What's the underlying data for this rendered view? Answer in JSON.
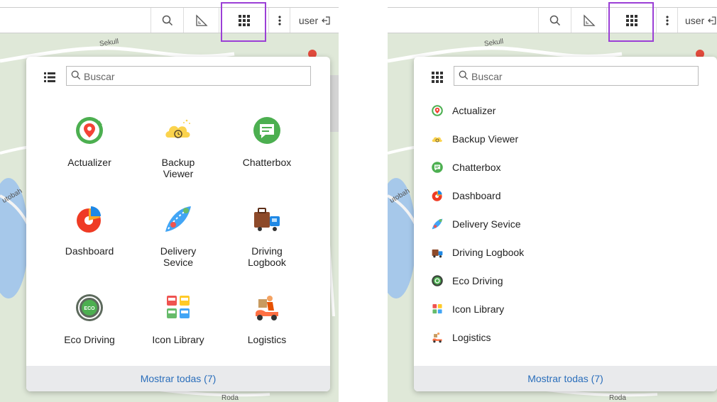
{
  "panels": [
    {
      "view": "grid",
      "topbar": {
        "user_label": "user"
      },
      "search": {
        "placeholder": "Buscar"
      },
      "apps": [
        {
          "label": "Actualizer",
          "icon": "actualizer-icon"
        },
        {
          "label": "Backup\nViewer",
          "icon": "backup-viewer-icon"
        },
        {
          "label": "Chatterbox",
          "icon": "chatterbox-icon"
        },
        {
          "label": "Dashboard",
          "icon": "dashboard-icon"
        },
        {
          "label": "Delivery\nSevice",
          "icon": "delivery-service-icon"
        },
        {
          "label": "Driving\nLogbook",
          "icon": "driving-logbook-icon"
        },
        {
          "label": "Eco Driving",
          "icon": "eco-driving-icon"
        },
        {
          "label": "Icon Library",
          "icon": "icon-library-icon"
        },
        {
          "label": "Logistics",
          "icon": "logistics-icon"
        }
      ],
      "footer": "Mostrar todas (7)",
      "map_labels": [
        "Sekull",
        "utobah",
        "Roda"
      ]
    },
    {
      "view": "list",
      "topbar": {
        "user_label": "user"
      },
      "search": {
        "placeholder": "Buscar"
      },
      "apps": [
        {
          "label": "Actualizer",
          "icon": "actualizer-icon"
        },
        {
          "label": "Backup Viewer",
          "icon": "backup-viewer-icon"
        },
        {
          "label": "Chatterbox",
          "icon": "chatterbox-icon"
        },
        {
          "label": "Dashboard",
          "icon": "dashboard-icon"
        },
        {
          "label": "Delivery Sevice",
          "icon": "delivery-service-icon"
        },
        {
          "label": "Driving Logbook",
          "icon": "driving-logbook-icon"
        },
        {
          "label": "Eco Driving",
          "icon": "eco-driving-icon"
        },
        {
          "label": "Icon Library",
          "icon": "icon-library-icon"
        },
        {
          "label": "Logistics",
          "icon": "logistics-icon"
        }
      ],
      "footer": "Mostrar todas (7)",
      "map_labels": [
        "Sekull",
        "utobah",
        "Roda"
      ]
    }
  ],
  "colors": {
    "highlight": "#9b3fd6",
    "link": "#2a6ebb",
    "footer_bg": "#e9eaec"
  }
}
